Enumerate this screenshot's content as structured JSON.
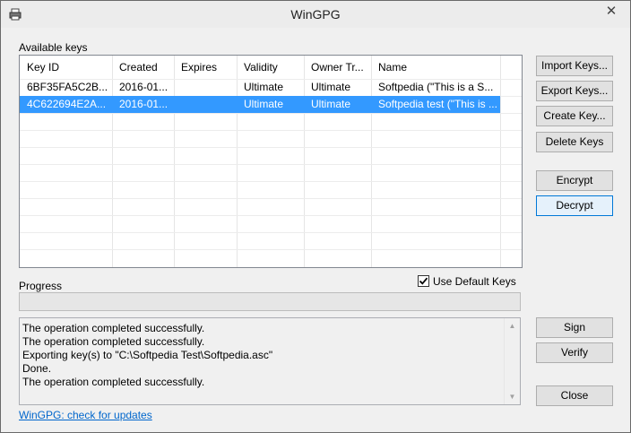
{
  "window": {
    "title": "WinGPG"
  },
  "keys_list": {
    "label": "Available keys",
    "columns": [
      "Key ID",
      "Created",
      "Expires",
      "Validity",
      "Owner Tr...",
      "Name"
    ],
    "rows": [
      [
        "6BF35FA5C2B...",
        "2016-01...",
        "",
        "Ultimate",
        "Ultimate",
        "Softpedia (\"This is a S..."
      ],
      [
        "4C622694E2A...",
        "2016-01...",
        "",
        "Ultimate",
        "Ultimate",
        "Softpedia test (\"This is ..."
      ]
    ],
    "selected_row": 1
  },
  "buttons": {
    "import_keys": "Import Keys...",
    "export_keys": "Export Keys...",
    "create_key": "Create Key...",
    "delete_keys": "Delete Keys",
    "encrypt": "Encrypt",
    "decrypt": "Decrypt",
    "sign": "Sign",
    "verify": "Verify",
    "close": "Close"
  },
  "progress": {
    "label": "Progress",
    "value": 0
  },
  "use_default_keys": {
    "label": "Use Default Keys",
    "checked": true
  },
  "log": {
    "lines": [
      "The operation completed successfully.",
      "The operation completed successfully.",
      "Exporting key(s) to \"C:\\Softpedia Test\\Softpedia.asc\"",
      "Done.",
      "The operation completed successfully."
    ]
  },
  "update_link": "WinGPG: check for updates",
  "colors": {
    "selection": "#3399ff",
    "link": "#0066cc",
    "focus_border": "#0078d7"
  }
}
